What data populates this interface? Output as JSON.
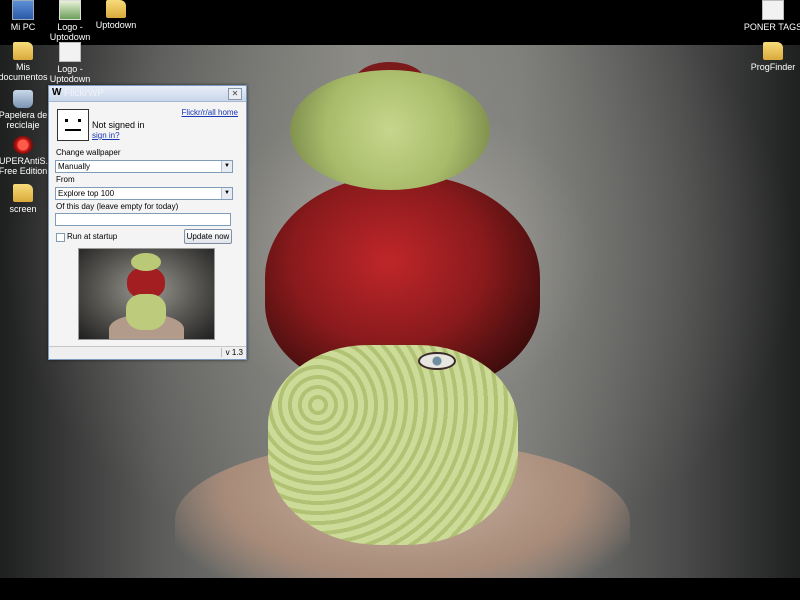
{
  "desktop": {
    "icons": [
      {
        "label": "Mi PC"
      },
      {
        "label": "Logo - Uptodown"
      },
      {
        "label": "Uptodown"
      },
      {
        "label": "Mis documentos"
      },
      {
        "label": "Logo - Uptodown"
      },
      {
        "label": "Papelera de reciclaje"
      },
      {
        "label": "SUPERAntiS... Free Edition"
      },
      {
        "label": "screen"
      },
      {
        "label": "PONER TAGS"
      },
      {
        "label": "ProgFinder"
      }
    ]
  },
  "window": {
    "title": "FlickrWP",
    "logo_letter": "W",
    "close_glyph": "✕",
    "account": {
      "status": "Not signed in",
      "sign_in_link": "sign in?",
      "home_link": "Flickr/r/all home"
    },
    "change_wallpaper_label": "Change wallpaper",
    "change_wallpaper_value": "Manually",
    "from_label": "From",
    "from_value": "Explore top 100",
    "date_label": "Of this day (leave empty for today)",
    "date_value": "",
    "run_at_startup_label": "Run at startup",
    "run_at_startup_checked": false,
    "update_button": "Update now",
    "version": "v 1.3"
  },
  "dropdown_glyph": "▼"
}
